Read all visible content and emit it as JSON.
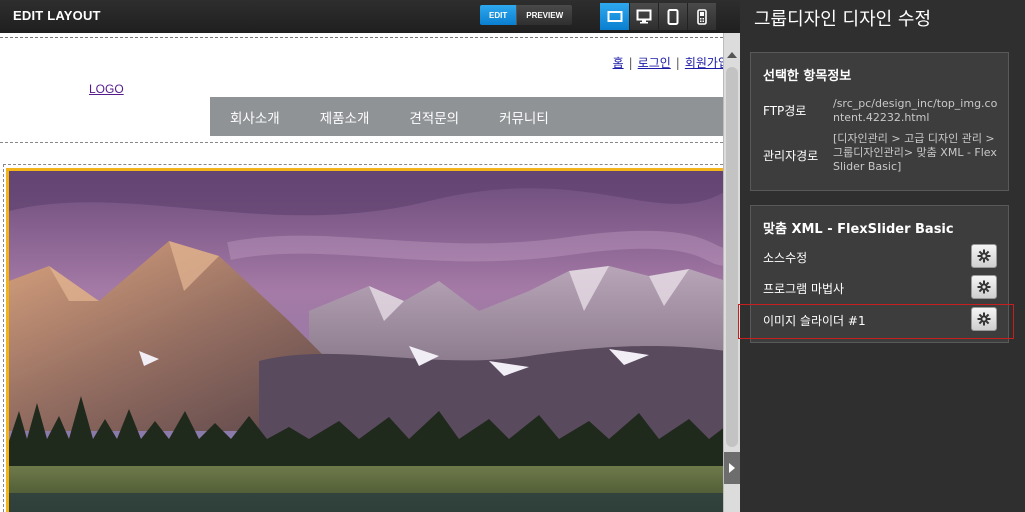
{
  "toolbar": {
    "title": "EDIT LAYOUT",
    "edit_label": "EDIT",
    "preview_label": "PREVIEW",
    "devices": [
      "monitor-wide-icon",
      "desktop-icon",
      "tablet-icon",
      "mobile-icon"
    ],
    "accent": "#1590e0"
  },
  "site": {
    "top_links": [
      "홈",
      "로그인",
      "회원가입"
    ],
    "logo": "LOGO",
    "nav": [
      "회사소개",
      "제품소개",
      "견적문의",
      "커뮤니티"
    ],
    "nav_color": "#8f9396",
    "slider_border_color": "#f2b31b"
  },
  "panel": {
    "title": "그룹디자인 디자인 수정",
    "info": {
      "title": "선택한 항목정보",
      "ftp_label": "FTP경로",
      "ftp_value": "/src_pc/design_inc/top_img.content.42232.html",
      "admin_label": "관리자경로",
      "admin_value": "[디자인관리 > 고급 디자인 관리 > 그룹디자인관리> 맞춤 XML - FlexSlider Basic]"
    },
    "xml": {
      "title": "맞춤 XML - FlexSlider Basic",
      "rows": [
        "소스수정",
        "프로그램 마법사",
        "이미지 슬라이더 #1"
      ]
    },
    "highlight_color": "#c81e1e"
  }
}
